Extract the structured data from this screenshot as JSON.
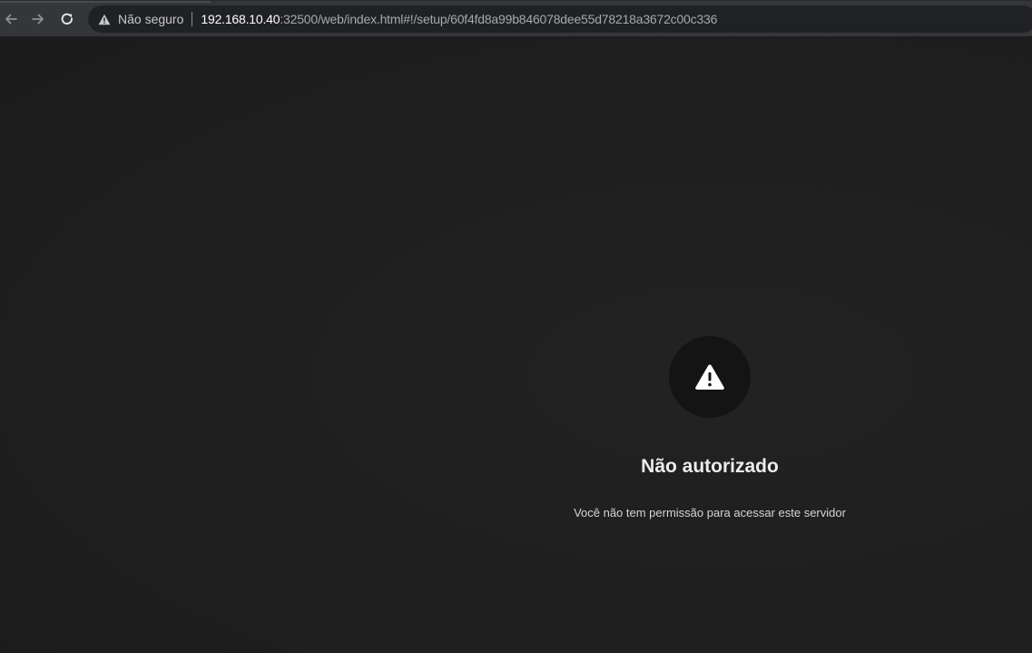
{
  "browser": {
    "security_label": "Não seguro",
    "url_host": "192.168.10.40",
    "url_rest": ":32500/web/index.html#!/setup/60f4fd8a99b846078dee55d78218a3672c00c336",
    "icons": {
      "back": "arrow-left-icon",
      "forward": "arrow-right-icon",
      "reload": "reload-icon",
      "security": "warning-triangle-icon"
    }
  },
  "error": {
    "icon": "warning-triangle-icon",
    "title": "Não autorizado",
    "message": "Você não tem permissão para acessar este servidor"
  },
  "colors": {
    "page_background": "#1f1f1f",
    "toolbar_background": "#35363a",
    "omnibox_background": "#202124",
    "icon_circle": "#141414",
    "title_text": "#ececec"
  }
}
